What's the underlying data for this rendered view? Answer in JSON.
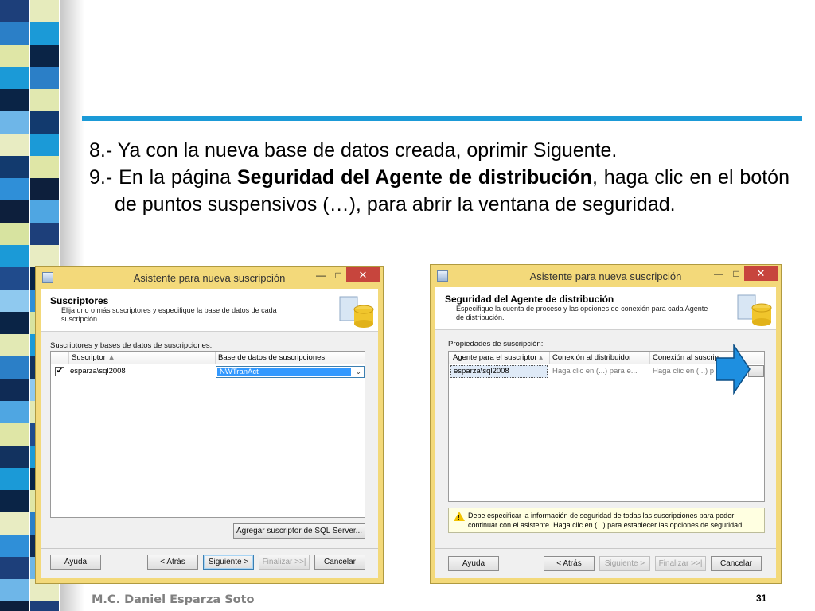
{
  "slide": {
    "item8": "8.- Ya con la nueva base de datos creada, oprimir Siguente.",
    "item9_pre": "9.- En la página ",
    "item9_bold": "Seguridad del Agente de distribución",
    "item9_post": ", haga clic en el botón de puntos suspensivos (…), para abrir la ventana de seguridad.",
    "author": "M.C. Daniel Esparza Soto",
    "page_number": "31"
  },
  "colors": {
    "accent_bar": "#1b9ad7",
    "window_frame": "#f3d97a",
    "close_button": "#c7453d",
    "selection": "#3399ff",
    "arrow_fill": "#1e8fe0"
  },
  "window1": {
    "title": "Asistente para nueva suscripción",
    "minimize": "—",
    "maximize": "□",
    "close": "✕",
    "header_title": "Suscriptores",
    "header_desc": "Elija uno o más suscriptores y especifique la base de datos de cada suscripción.",
    "list_label": "Suscriptores y bases de datos de suscripciones:",
    "col_subscriber": "Suscriptor",
    "col_database": "Base de datos de suscripciones",
    "row_checked": "✔",
    "row_subscriber": "esparza\\sql2008",
    "row_database": "NWTranAct",
    "add_button": "Agregar suscriptor de SQL Server...",
    "buttons": {
      "help": "Ayuda",
      "back": "< Atrás",
      "next": "Siguiente >",
      "finish": "Finalizar >>|",
      "cancel": "Cancelar"
    }
  },
  "window2": {
    "title": "Asistente para nueva suscripción",
    "minimize": "—",
    "maximize": "□",
    "close": "✕",
    "header_title": "Seguridad del Agente de distribución",
    "header_desc": "Especifique la cuenta de proceso y las opciones de conexión para cada Agente de distribución.",
    "list_label": "Propiedades de suscripción:",
    "col_agent": "Agente para el suscriptor",
    "col_dist_conn": "Conexión al distribuidor",
    "col_sub_conn": "Conexión al suscrip",
    "row_agent": "esparza\\sql2008",
    "row_dist_conn": "Haga clic en (...) para e...",
    "row_sub_conn": "Haga clic en (...) p",
    "ellipsis_button": "...",
    "warning": "Debe especificar la información de seguridad de todas las suscripciones para poder continuar con el asistente. Haga clic en (...) para establecer las opciones de seguridad.",
    "buttons": {
      "help": "Ayuda",
      "back": "< Atrás",
      "next": "Siguiente >",
      "finish": "Finalizar >>|",
      "cancel": "Cancelar"
    }
  }
}
